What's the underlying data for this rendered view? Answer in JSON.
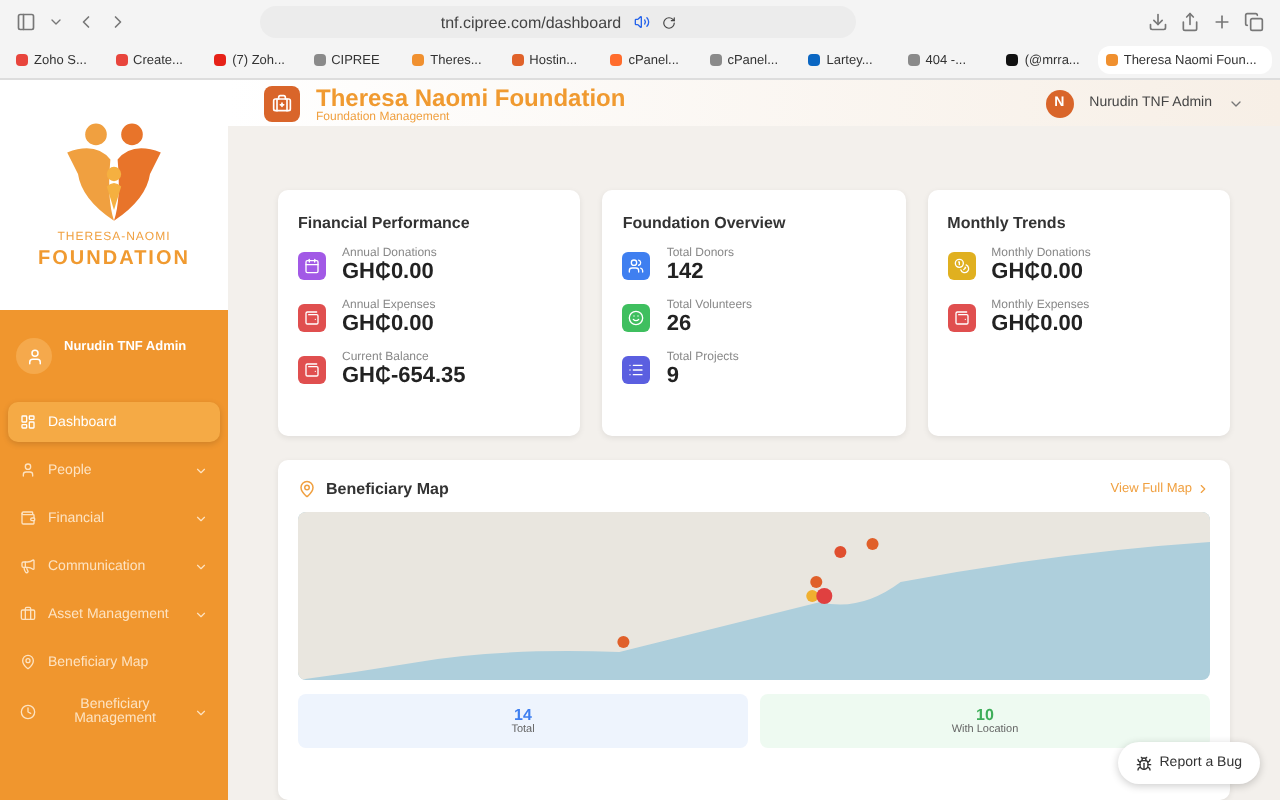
{
  "browser": {
    "url": "tnf.cipree.com/dashboard",
    "tabs": [
      {
        "label": "Zoho S...",
        "selected": false,
        "color": "#e8453c"
      },
      {
        "label": "Create...",
        "selected": false,
        "color": "#e8453c"
      },
      {
        "label": "(7) Zoh...",
        "selected": false,
        "color": "#e62117"
      },
      {
        "label": "CIPREE",
        "selected": false,
        "color": "#8a8a8a"
      },
      {
        "label": "Theres...",
        "selected": false,
        "color": "#f0902f"
      },
      {
        "label": "Hostin...",
        "selected": false,
        "color": "#e0622a"
      },
      {
        "label": "cPanel...",
        "selected": false,
        "color": "#ff6c2c"
      },
      {
        "label": "cPanel...",
        "selected": false,
        "color": "#8a8a8a"
      },
      {
        "label": "Lartey...",
        "selected": false,
        "color": "#0a66c2"
      },
      {
        "label": "404 -...",
        "selected": false,
        "color": "#8a8a8a"
      },
      {
        "label": "(@mrra...",
        "selected": false,
        "color": "#111111"
      },
      {
        "label": "Theresa Naomi Foun...",
        "selected": true,
        "color": "#f0902f"
      }
    ]
  },
  "sidebar": {
    "logo": {
      "line_1": "THERESA-NAOMI",
      "line_2": "FOUNDATION"
    },
    "user": "Nurudin TNF Admin",
    "items": [
      {
        "label": "Dashboard",
        "selected": true,
        "expandable": false
      },
      {
        "label": "People",
        "selected": false,
        "expandable": true
      },
      {
        "label": "Financial",
        "selected": false,
        "expandable": true
      },
      {
        "label": "Communication",
        "selected": false,
        "expandable": true
      },
      {
        "label": "Asset Management",
        "selected": false,
        "expandable": true
      },
      {
        "label": "Beneficiary Map",
        "selected": false,
        "expandable": false
      },
      {
        "label": "Beneficiary Management",
        "selected": false,
        "expandable": true
      }
    ]
  },
  "header": {
    "title": "Theresa Naomi Foundation",
    "subtitle": "Foundation Management",
    "user_initial": "N",
    "user": "Nurudin TNF Admin"
  },
  "cards": [
    {
      "title": "Financial Performance",
      "stats": [
        {
          "label": "Annual Donations",
          "value": "GH₵0.00",
          "color": "#a259e6"
        },
        {
          "label": "Annual Expenses",
          "value": "GH₵0.00",
          "color": "#e04f4f"
        },
        {
          "label": "Current Balance",
          "value": "GH₵-654.35",
          "color": "#e04f4f"
        }
      ]
    },
    {
      "title": "Foundation Overview",
      "stats": [
        {
          "label": "Total Donors",
          "value": "142",
          "color": "#3f7ff0"
        },
        {
          "label": "Total Volunteers",
          "value": "26",
          "color": "#3fbf5f"
        },
        {
          "label": "Total Projects",
          "value": "9",
          "color": "#5b5fe0"
        }
      ]
    },
    {
      "title": "Monthly Trends",
      "stats": [
        {
          "label": "Monthly Donations",
          "value": "GH₵0.00",
          "color": "#e0b020"
        },
        {
          "label": "Monthly Expenses",
          "value": "GH₵0.00",
          "color": "#e04f4f"
        }
      ]
    }
  ],
  "map": {
    "title": "Beneficiary Map",
    "link": "View Full Map",
    "counts": [
      {
        "value": "14",
        "label": "Total",
        "color": "#3f7ff0"
      },
      {
        "value": "10",
        "label": "With Location",
        "color": "#3fae5a"
      }
    ]
  },
  "report_button": "Report a Bug"
}
